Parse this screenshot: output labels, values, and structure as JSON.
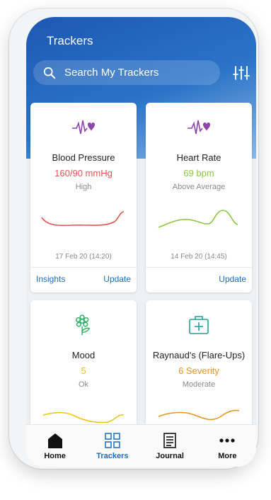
{
  "header": {
    "title": "Trackers"
  },
  "search": {
    "placeholder": "Search My Trackers"
  },
  "colors": {
    "accent": "#1f6bb5",
    "heart_icon": "#8e44ad",
    "red": "#e05555",
    "green": "#8cc63f",
    "yellow": "#f1c40f",
    "orange": "#e69520",
    "mood_icon": "#27ae60",
    "med_icon": "#1aa39a"
  },
  "cards": [
    {
      "name": "Blood Pressure",
      "value": "160/90 mmHg",
      "status": "High",
      "date": "17 Feb 20 (14:20)",
      "left_action": "Insights",
      "right_action": "Update",
      "icon": "heart-pulse-icon"
    },
    {
      "name": "Heart Rate",
      "value": "69 bpm",
      "status": "Above Average",
      "date": "14 Feb 20 (14:45)",
      "right_action": "Update",
      "icon": "heart-pulse-icon"
    },
    {
      "name": "Mood",
      "value": "5",
      "status": "Ok",
      "icon": "flower-icon"
    },
    {
      "name": "Raynaud's (Flare-Ups)",
      "value": "6 Severity",
      "status": "Moderate",
      "icon": "medical-kit-icon"
    }
  ],
  "tabs": [
    {
      "label": "Home",
      "icon": "home-icon"
    },
    {
      "label": "Trackers",
      "icon": "grid-icon",
      "active": true
    },
    {
      "label": "Journal",
      "icon": "journal-icon"
    },
    {
      "label": "More",
      "icon": "more-icon"
    }
  ]
}
